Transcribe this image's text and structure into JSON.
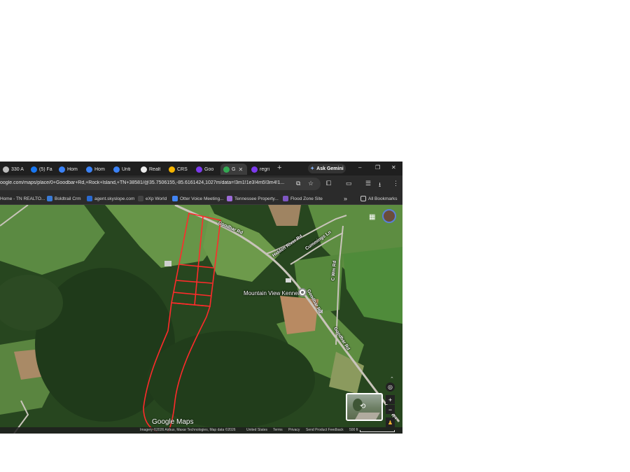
{
  "tabs": [
    {
      "title": "330 A",
      "favicon_color": "#bdbdbd",
      "active": false
    },
    {
      "title": "(5) Fa",
      "favicon_color": "#1877f2",
      "active": false
    },
    {
      "title": "Hom",
      "favicon_color": "#3b82f6",
      "active": false
    },
    {
      "title": "Hom",
      "favicon_color": "#3b82f6",
      "active": false
    },
    {
      "title": "Unti",
      "favicon_color": "#3b82f6",
      "active": false
    },
    {
      "title": "Realt",
      "favicon_color": "#eeeeee",
      "active": false
    },
    {
      "title": "CRS",
      "favicon_color": "#f5b400",
      "active": false
    },
    {
      "title": "Goo",
      "favicon_color": "#7c3aed",
      "active": false
    },
    {
      "title": "G",
      "favicon_color": "#34a853",
      "active": true
    },
    {
      "title": "regri",
      "favicon_color": "#7c3aed",
      "active": false
    }
  ],
  "toolbar": {
    "new_tab": "+",
    "ask_gemini": "Ask Gemini",
    "minimize": "–",
    "restore": "❐",
    "close": "✕",
    "url": "oogle.com/maps/place/0+Goodbar+Rd,+Rock+Island,+TN+38581/@35.7506155,-85.6161424,1027m/data=!3m1!1e3!4m5!3m4!1..."
  },
  "bookmarks": [
    {
      "label": "Home - TN REALTO...",
      "color": "#1e88e5"
    },
    {
      "label": "Boldtrail Crm",
      "color": "#3a7bd5"
    },
    {
      "label": "agent.skyslope.com",
      "color": "#2a6ad0"
    },
    {
      "label": "eXp World",
      "color": "#444444"
    },
    {
      "label": "Otter Voice Meeting...",
      "color": "#4285f4"
    },
    {
      "label": "Tennessee Property...",
      "color": "#9c6bd8"
    },
    {
      "label": "Flood Zone Site",
      "color": "#7e57c2"
    }
  ],
  "bookmarks_more": "»",
  "all_bookmarks": "All Bookmarks",
  "map": {
    "place_name": "Mountain View Kennels",
    "roads": {
      "goodbar_top": "Goodbar Rd",
      "hidden_river": "Hidden River Rd",
      "cummings": "Cummings Ln",
      "c_wm": "C Wm Rd",
      "goodbar_mid": "Goodbar Rd",
      "goodbar_low": "Goodbar Rd",
      "goodbar_edge": "Rd"
    },
    "logo": "Google Maps",
    "attribution": {
      "imagery": "Imagery ©2026 Airbus, Maxar Technologies, Map data ©2026",
      "region": "United States",
      "terms": "Terms",
      "privacy": "Privacy",
      "feedback": "Send Product Feedback",
      "scale": "500 ft"
    },
    "colors": {
      "parcel_outline": "#ff2b2b",
      "road": "#c9c4bb"
    }
  }
}
